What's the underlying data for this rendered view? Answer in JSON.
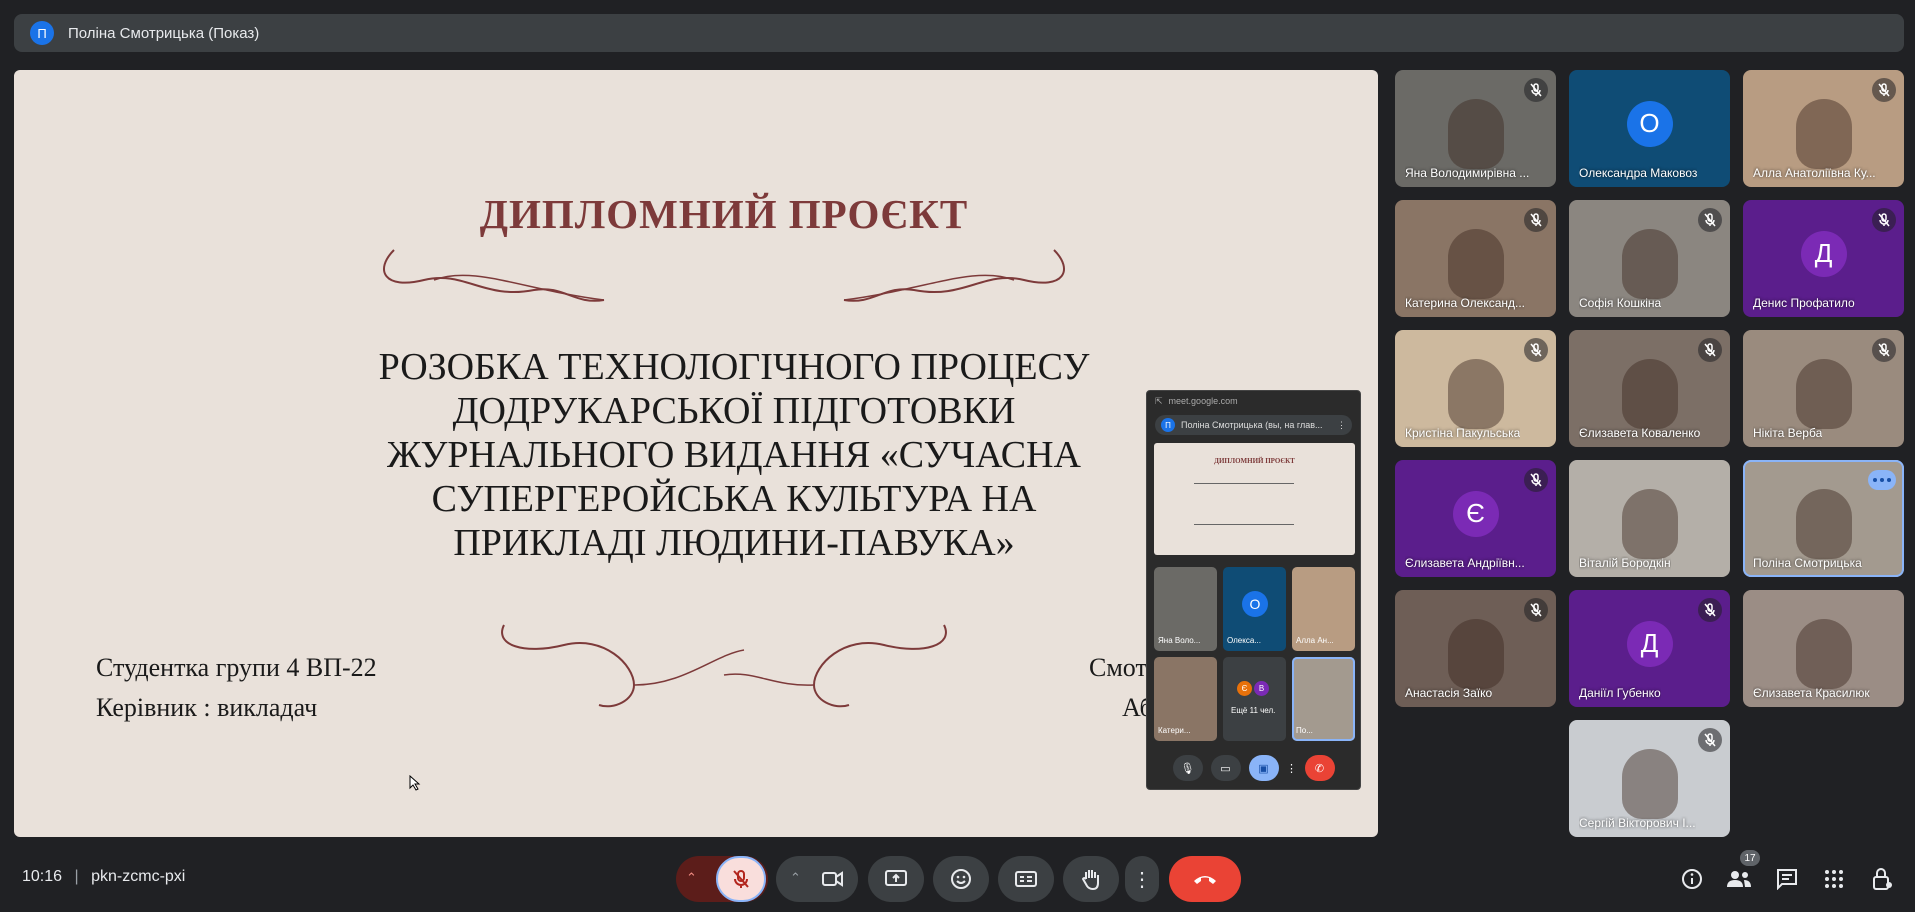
{
  "topbar": {
    "avatar_letter": "П",
    "title": "Поліна Смотрицька (Показ)"
  },
  "slide": {
    "heading": "ДИПЛОМНИЙ ПРОЄКТ",
    "main_lines": [
      "РОЗОБКА ТЕХНОЛОГІЧНОГО ПРОЦЕСУ",
      "ДОДРУКАРСЬКОЇ ПІДГОТОВКИ",
      "ЖУРНАЛЬНОГО ВИДАННЯ «СУЧАСНА",
      "СУПЕРГЕРОЙСЬКА КУЛЬТУРА НА",
      "ПРИКЛАДІ ЛЮДИНИ-ПАВУКА»"
    ],
    "student_label": "Студентка групи 4 ВП-22",
    "supervisor_label": "Керівник : викладач",
    "student_name_partial": "Смот",
    "supervisor_name_partial": "Аб"
  },
  "mini_window": {
    "url": "meet.google.com",
    "avatar_letter": "П",
    "presenter": "Поліна Смотрицька (вы, на глав...",
    "thumb_heading": "ДИПЛОМНИЙ ПРОЄКТ",
    "tiles": [
      {
        "name": "Яна Воло...",
        "avatar": ""
      },
      {
        "name": "Олекса...",
        "avatar": "О"
      },
      {
        "name": "Алла Ан...",
        "avatar": ""
      },
      {
        "name": "Катери...",
        "avatar": ""
      },
      {
        "name": "Ещё 11 чел.",
        "avatar": ""
      },
      {
        "name": "По...",
        "avatar": ""
      }
    ],
    "more_avatars": [
      "Є",
      "В"
    ]
  },
  "participants": [
    {
      "name": "Яна Володимирівна ...",
      "type": "video",
      "bg": "#6b6a66",
      "muted": true
    },
    {
      "name": "Олександра Маковоз",
      "type": "avatar",
      "letter": "О",
      "bg": "#0f4c75",
      "avatar_color": "#1a73e8",
      "muted": false
    },
    {
      "name": "Алла Анатоліївна Ку...",
      "type": "video",
      "bg": "#b89c82",
      "muted": true
    },
    {
      "name": "Катерина Олександ...",
      "type": "video",
      "bg": "#8a7565",
      "muted": true
    },
    {
      "name": "Софія Кошкіна",
      "type": "video",
      "bg": "#8b8680",
      "muted": true
    },
    {
      "name": "Денис Профатило",
      "type": "avatar",
      "letter": "Д",
      "bg": "#5b1e8c",
      "avatar_color": "#7b2ab5",
      "muted": true
    },
    {
      "name": "Кристіна Пакульська",
      "type": "video",
      "bg": "#cdb99e",
      "muted": true
    },
    {
      "name": "Єлизавета Коваленко",
      "type": "video",
      "bg": "#7c6f66",
      "muted": true
    },
    {
      "name": "Нікіта Верба",
      "type": "video",
      "bg": "#9a8b7e",
      "muted": true
    },
    {
      "name": "Єлизавета Андріївн...",
      "type": "avatar",
      "letter": "Є",
      "bg": "#5b1e8c",
      "avatar_color": "#7b2ab5",
      "muted": true
    },
    {
      "name": "Віталій Бородкін",
      "type": "video",
      "bg": "#b4afa8",
      "muted": false
    },
    {
      "name": "Поліна Смотрицька",
      "type": "video",
      "bg": "#a39a8f",
      "muted": false,
      "active": true
    },
    {
      "name": "Анастасія Заїко",
      "type": "video",
      "bg": "#6e5e56",
      "muted": true
    },
    {
      "name": "Даніїл Губенко",
      "type": "avatar",
      "letter": "Д",
      "bg": "#5b1e8c",
      "avatar_color": "#7b2ab5",
      "muted": true
    },
    {
      "name": "Єлизавета Красилюк",
      "type": "video",
      "bg": "#9b8d85",
      "muted": false
    },
    {
      "name": "",
      "type": "empty"
    },
    {
      "name": "Сергій Вікторович І...",
      "type": "video",
      "bg": "#c9ccd0",
      "muted": true
    }
  ],
  "bottom": {
    "time": "10:16",
    "meeting_code": "pkn-zcmc-pxi",
    "participant_count": "17",
    "accent_red": "#ea4335"
  }
}
